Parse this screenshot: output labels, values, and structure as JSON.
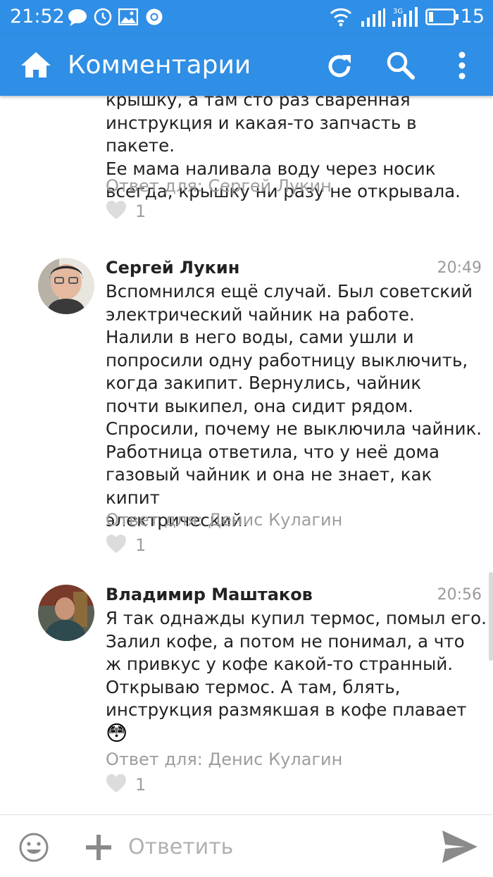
{
  "status_bar": {
    "time": "21:52",
    "notification_icons": [
      "chat-bubble-icon",
      "clock-icon",
      "image-icon",
      "chrome-icon"
    ],
    "network_label": "3G",
    "battery_level": "15"
  },
  "app_bar": {
    "title": "Комментарии",
    "icons": [
      "home-icon",
      "refresh-icon",
      "search-icon",
      "more-vert-icon"
    ],
    "color": "#2f8ee5"
  },
  "comments": [
    {
      "author": "",
      "time": "",
      "text": "крышку, а там сто раз сваренная\nинструкция и какая-то запчасть в пакете.\nЕе мама наливала воду через носик\nвсегда, крышку ни разу не открывала.",
      "reply_to": "Ответ для: Сергей Лукин",
      "likes": "1"
    },
    {
      "author": "Сергей Лукин",
      "time": "20:49",
      "text": "Вспомнился ещё случай. Был советский\nэлектрический чайник на работе.\nНалили в него воды, сами ушли и\nпопросили одну работницу выключить,\nкогда закипит. Вернулись, чайник\nпочти выкипел, она сидит рядом.\nСпросили, почему не выключила чайник.\nРаботница ответила, что у неё дома\nгазовый чайник и она не знает, как кипит\nэлектрический.",
      "reply_to": "Ответ для: Денис Кулагин",
      "likes": "1"
    },
    {
      "author": "Владимир Маштаков",
      "time": "20:56",
      "text": "Я так однажды купил термос, помыл его.\nЗалил кофе, а потом не понимал, а что\nж привкус у кофе какой-то странный.\nОткрываю термос. А там, блять,\nинструкция размякшая в кофе плавает",
      "emoji": "😳",
      "reply_to": "Ответ для: Денис Кулагин",
      "likes": "1"
    }
  ],
  "bottom_bar": {
    "placeholder": "Ответить",
    "icons": [
      "emoji-icon",
      "add-icon",
      "send-icon"
    ]
  }
}
